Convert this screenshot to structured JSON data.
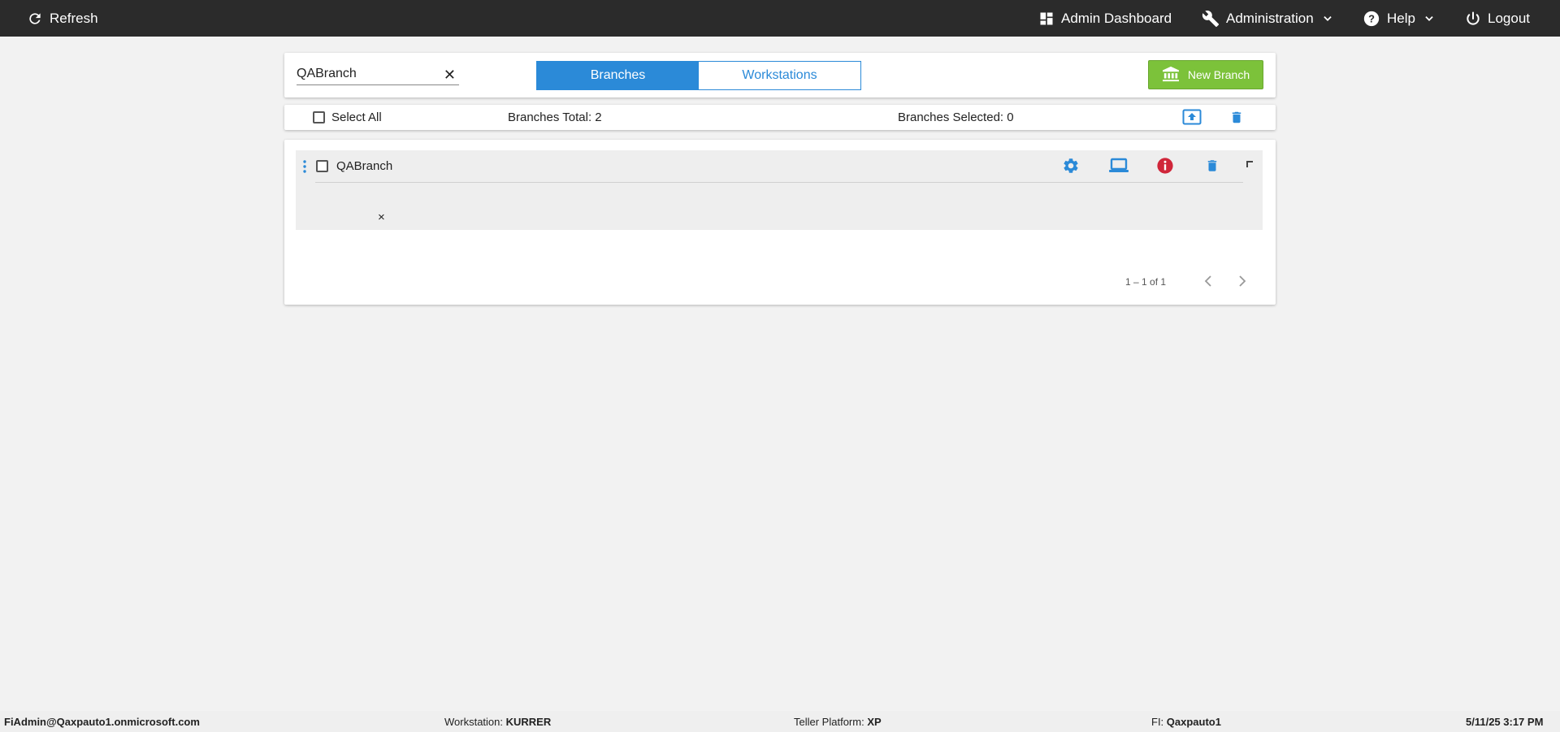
{
  "topbar": {
    "refresh_label": "Refresh",
    "dashboard_label": "Admin Dashboard",
    "administration_label": "Administration",
    "help_label": "Help",
    "logout_label": "Logout"
  },
  "search": {
    "value": "QABranch",
    "clear_icon": "close-icon"
  },
  "tabs": {
    "branches_label": "Branches",
    "workstations_label": "Workstations",
    "active": "Branches"
  },
  "new_branch_label": "New Branch",
  "toolbar": {
    "select_all_label": "Select All",
    "branches_total": "Branches Total: 2",
    "branches_selected": "Branches Selected: 0"
  },
  "branches": [
    {
      "name": "QABranch",
      "status": "info-error"
    }
  ],
  "row_remove_glyph": "×",
  "pager": {
    "range_label": "1 – 1 of 1"
  },
  "footer": {
    "user": "FiAdmin@Qaxpauto1.onmicrosoft.com",
    "workstation_label": "Workstation: ",
    "workstation_value": "KURRER",
    "platform_label": "Teller Platform: ",
    "platform_value": "XP",
    "fi_label": "FI: ",
    "fi_value": "Qaxpauto1",
    "datetime": "5/11/25 3:17 PM"
  },
  "colors": {
    "topbar_bg": "#2b2b2b",
    "accent_blue": "#2b8ad8",
    "new_branch_green": "#7cc23a",
    "alert_red": "#d0263a"
  }
}
